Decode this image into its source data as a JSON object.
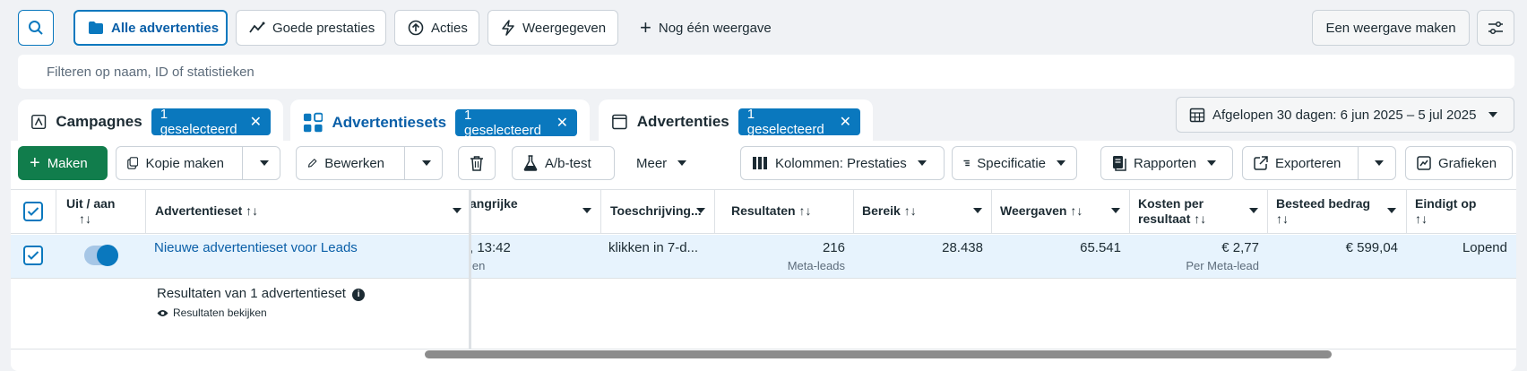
{
  "top_bar": {
    "view_tabs": [
      {
        "label": "Alle advertenties",
        "active": true
      },
      {
        "label": "Goede prestaties",
        "active": false
      },
      {
        "label": "Acties",
        "active": false
      },
      {
        "label": "Weergegeven",
        "active": false
      }
    ],
    "add_view_label": "Nog één weergave",
    "create_view_label": "Een weergave maken"
  },
  "search": {
    "placeholder": "Filteren op naam, ID of statistieken"
  },
  "level_tabs": {
    "campaigns": {
      "label": "Campagnes",
      "pill": "1 geselecteerd"
    },
    "adsets": {
      "label": "Advertentiesets",
      "pill": "1 geselecteerd"
    },
    "ads": {
      "label": "Advertenties",
      "pill": "1 geselecteerd"
    }
  },
  "date_range": {
    "label": "Afgelopen 30 dagen: 6 jun 2025 – 5 jul 2025"
  },
  "toolbar": {
    "create": "Maken",
    "duplicate": "Kopie maken",
    "edit": "Bewerken",
    "ab_test": "A/b-test",
    "more": "Meer",
    "columns": "Kolommen: Prestaties",
    "breakdown": "Specificatie",
    "reports": "Rapporten",
    "export": "Exporteren",
    "charts": "Grafieken"
  },
  "columns": {
    "on_off": "Uit / aan",
    "on_off_sort": "↑↓",
    "adset": "Advertentieset ↑↓",
    "important": "angrijke",
    "attribution": "Toeschrijving...",
    "results": "Resultaten ↑↓",
    "reach": "Bereik ↑↓",
    "impressions": "Weergaven ↑↓",
    "cost_per_result": "Kosten per",
    "cost_per_result_2": "resultaat ↑↓",
    "amount_spent": "Besteed bedrag",
    "amount_spent_sort": "↑↓",
    "ends": "Eindigt op",
    "ends_sort": "↑↓"
  },
  "row": {
    "adset_name": "Nieuwe advertentieset voor Leads",
    "important_value": ", 13:42",
    "important_sub": "len",
    "attribution": "klikken in 7-d...",
    "results": "216",
    "results_sub": "Meta-leads",
    "reach": "28.438",
    "impressions": "65.541",
    "cost_per_result": "€ 2,77",
    "cost_per_result_sub": "Per Meta-lead",
    "amount_spent": "€ 599,04",
    "ends": "Lopend"
  },
  "summary": {
    "label": "Resultaten van 1 advertentieset",
    "view_results": "Resultaten bekijken"
  },
  "colors": {
    "accent": "#0a78be",
    "create_green": "#117d4c"
  }
}
